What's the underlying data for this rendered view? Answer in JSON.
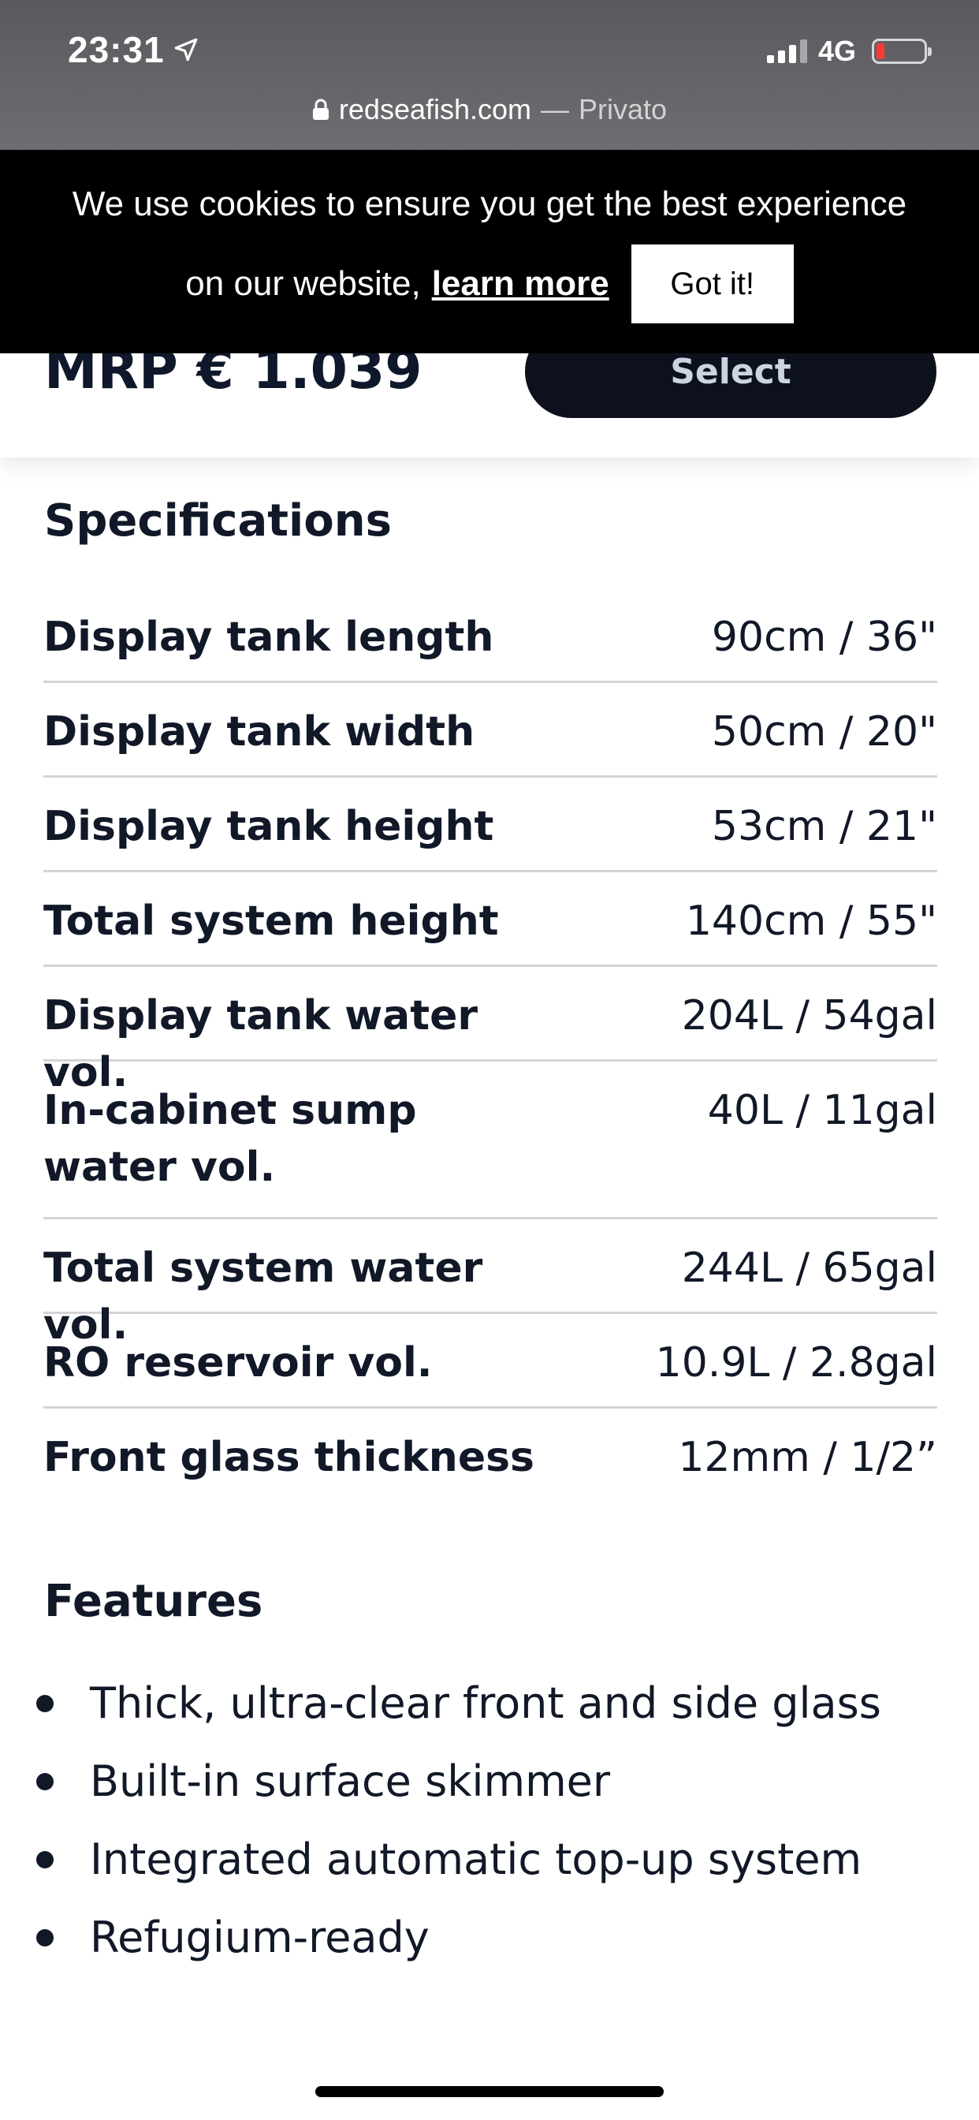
{
  "status_bar": {
    "time": "23:31",
    "network": "4G"
  },
  "url_bar": {
    "domain": "redseafish.com",
    "separator": "—",
    "mode": "Privato"
  },
  "cookie_banner": {
    "text_line1": "We use cookies to ensure you get the best experience",
    "text_line2": "on our website,",
    "learn_more": "learn more",
    "button": "Got it!"
  },
  "product_bar": {
    "price": "MRP € 1.039",
    "select_label": "Select"
  },
  "specifications": {
    "title": "Specifications",
    "rows": [
      {
        "label": "Display tank length",
        "value": "90cm / 36\""
      },
      {
        "label": "Display tank width",
        "value": "50cm / 20\""
      },
      {
        "label": "Display tank height",
        "value": "53cm / 21\""
      },
      {
        "label": "Total system height",
        "value": "140cm / 55\""
      },
      {
        "label": "Display tank water vol.",
        "value": "204L / 54gal"
      },
      {
        "label": "In-cabinet sump water vol.",
        "value": "40L / 11gal"
      },
      {
        "label": "Total system water vol.",
        "value": "244L / 65gal"
      },
      {
        "label": "RO reservoir vol.",
        "value": "10.9L / 2.8gal"
      },
      {
        "label": "Front glass thickness",
        "value": "12mm / 1/2”"
      }
    ]
  },
  "features": {
    "title": "Features",
    "items": [
      "Thick, ultra-clear front and side glass",
      "Built-in surface skimmer",
      "Integrated automatic top-up system",
      "Refugium-ready"
    ]
  },
  "colors": {
    "dark_button": "#0c111d",
    "text": "#111827",
    "battery_low": "#ff3b30"
  }
}
